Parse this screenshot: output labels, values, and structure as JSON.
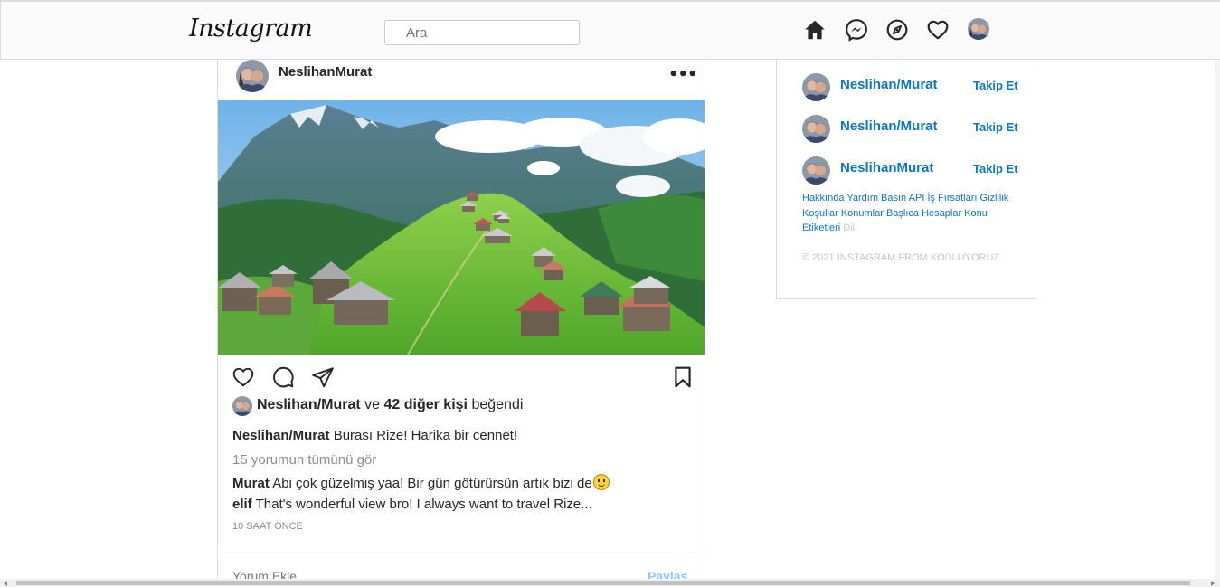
{
  "nav": {
    "logo": "Instagram",
    "search_placeholder": "Ara",
    "icons": [
      "home-icon",
      "messenger-icon",
      "explore-compass-icon",
      "heart-icon",
      "profile-avatar"
    ]
  },
  "post": {
    "username": "NeslihanMurat",
    "more_label": "•••",
    "image_description_icon": "mountain-village-photo",
    "actions": [
      "like-heart-icon",
      "comment-bubble-icon",
      "share-paper-plane-icon",
      "save-bookmark-icon"
    ],
    "likes": {
      "user": "Neslihan/Murat",
      "connector": "ve",
      "others": "42 diğer kişi",
      "suffix": "beğendi"
    },
    "caption": {
      "user": "Neslihan/Murat",
      "text": "Burası Rize! Harika bir cennet!"
    },
    "view_all_comments": "15 yorumun tümünü gör",
    "comments": [
      {
        "user": "Murat",
        "text": "Abi çok güzelmiş yaa! Bir gün götürürsün artık bizi de"
      },
      {
        "user": "elif",
        "text": "That's wonderful view bro! I always want to travel Rize..."
      }
    ],
    "time": "10 SAAT ÖNCE",
    "comment_placeholder": "Yorum Ekle...",
    "share_label": "Paylaş"
  },
  "sidebar": {
    "suggestions": [
      {
        "name": "Neslihan/Murat",
        "follow": "Takip Et"
      },
      {
        "name": "Neslihan/Murat",
        "follow": "Takip Et"
      },
      {
        "name": "NeslihanMurat",
        "follow": "Takip Et"
      }
    ],
    "footer_links": [
      "Hakkında",
      "Yardım",
      "Basın",
      "API",
      "İş Fırsatları",
      "Gizlilik",
      "Koşullar",
      "Konumlar",
      "Başlıca Hesaplar",
      "Konu Etiketleri"
    ],
    "footer_muted": "Dil",
    "copyright": "© 2021 INSTAGRAM FROM KODLUYORUZ"
  },
  "colors": {
    "link_blue": "#0f75c9",
    "share_blue_disabled": "#8fc7f5",
    "border": "#dbdbdb",
    "muted_text": "#8e8e8e"
  }
}
